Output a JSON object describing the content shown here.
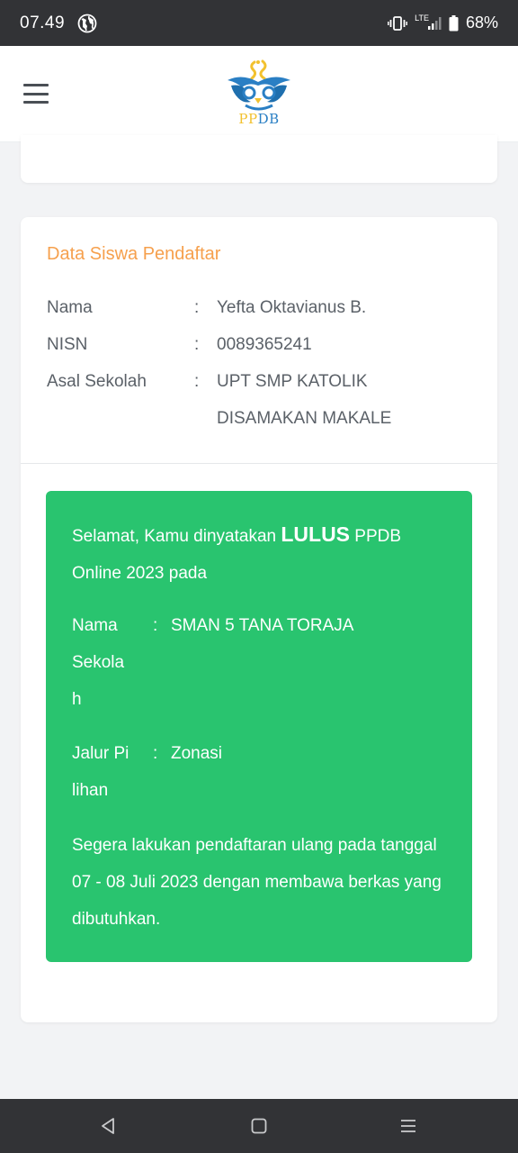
{
  "status_bar": {
    "time": "07.49",
    "network": "LTE",
    "battery": "68%",
    "icons": [
      "globe-icon",
      "vibrate-icon",
      "signal-icon",
      "battery-icon"
    ]
  },
  "header": {
    "logo_text_pp": "PP",
    "logo_text_db": "DB",
    "menu_icon": "hamburger-menu-icon"
  },
  "student": {
    "title": "Data Siswa Pendaftar",
    "fields": [
      {
        "label": "Nama",
        "value": "Yefta Oktavianus B."
      },
      {
        "label": "NISN",
        "value": "0089365241"
      },
      {
        "label": "Asal Sekolah",
        "value": "UPT SMP KATOLIK DISAMAKAN MAKALE"
      }
    ],
    "colon": ":"
  },
  "result": {
    "intro_before": "Selamat, Kamu dinyatakan ",
    "intro_highlight": "LULUS",
    "intro_after": " PPDB Online 2023 pada",
    "fields": [
      {
        "label": "Nama Sekolah",
        "value": "SMAN 5 TANA TORAJA"
      },
      {
        "label": "Jalur Pilihan",
        "value": "Zonasi"
      }
    ],
    "colon": ":",
    "note": "Segera lakukan pendaftaran ulang pada tanggal 07 - 08 Juli 2023 dengan membawa berkas yang dibutuhkan."
  },
  "colors": {
    "accent_orange": "#f6a04d",
    "success_green": "#29c46f",
    "status_bar": "#323336",
    "logo_yellow": "#f2c12e",
    "logo_blue": "#2a7fc4"
  },
  "nav": {
    "back": "back-icon",
    "home": "home-icon",
    "recents": "recents-icon"
  }
}
